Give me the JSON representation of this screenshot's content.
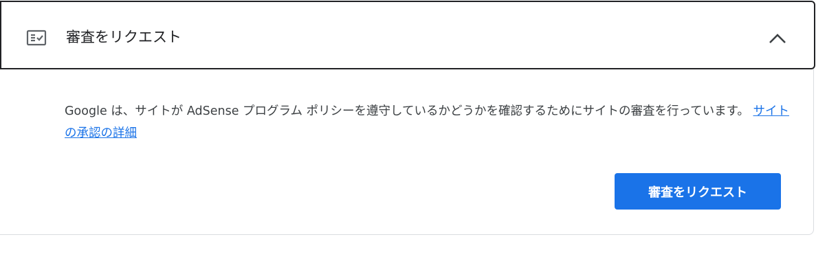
{
  "panel": {
    "title": "審査をリクエスト",
    "header_icon": "fact-check-icon",
    "toggle_icon": "chevron-up-icon",
    "expanded": true
  },
  "content": {
    "description": "Google は、サイトが AdSense プログラム ポリシーを遵守しているかどうかを確認するためにサイトの審査を行っています。",
    "link_text": "サイトの承認の詳細"
  },
  "actions": {
    "request_review_label": "審査をリクエスト"
  },
  "colors": {
    "accent": "#1a73e8",
    "text": "#202124",
    "body_text": "#3c4043",
    "border": "#dadce0"
  }
}
